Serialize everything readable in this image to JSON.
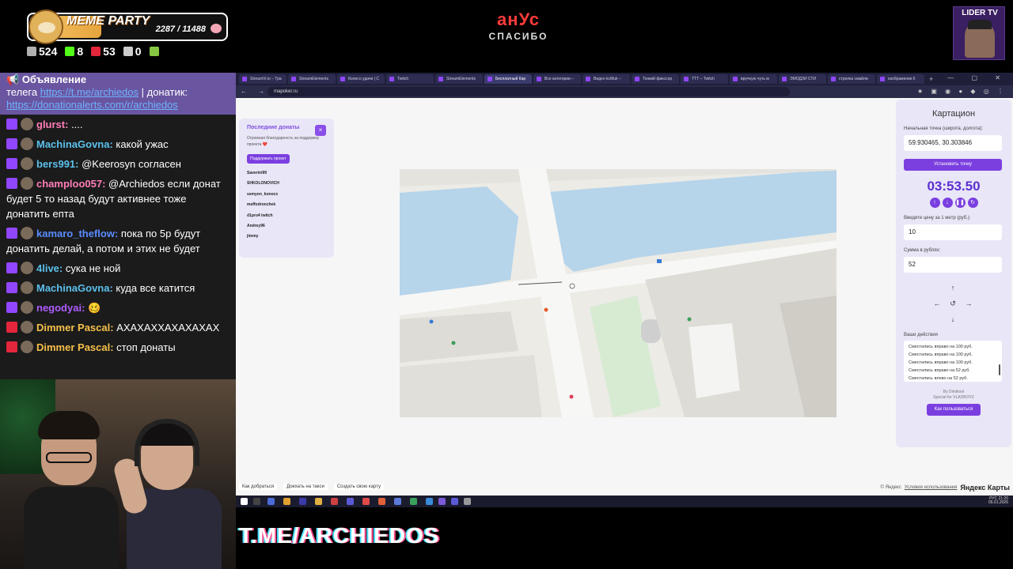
{
  "overlay": {
    "meme_party": {
      "title": "MEME PARTY",
      "count": "2287 / 11488",
      "progress": 0.199
    },
    "stats": [
      {
        "icon": "comment-icon",
        "value": "524",
        "color": "#b0b0b0"
      },
      {
        "icon": "kick-icon",
        "value": "8",
        "color": "#53fc18"
      },
      {
        "icon": "vk-live-icon",
        "value": "53",
        "color": "#e3263b"
      },
      {
        "icon": "wasd-icon",
        "value": "0",
        "color": "#cccccc"
      },
      {
        "icon": "rumble-icon",
        "value": "",
        "color": "#85c742"
      }
    ],
    "center": {
      "line1": "анУс",
      "line2": "СПАСИБО"
    },
    "lider": {
      "label": "LIDER TV"
    },
    "ticker": "T.ME/ARCHIEDOS"
  },
  "chat": {
    "announcement": {
      "title": "Объявление",
      "text_prefix": "телега ",
      "link1": "https://t.me/archiedos",
      "text_mid": " | донатик:",
      "link2": "https://donationalerts.com/r/archiedos"
    },
    "messages": [
      {
        "platform": "twitch",
        "nick": "glurst:",
        "color": "#ff7eb8",
        "text": " ...."
      },
      {
        "platform": "twitch",
        "nick": "MachinaGovna:",
        "color": "#5bc0eb",
        "text": " какой ужас"
      },
      {
        "platform": "twitch",
        "nick": "bers991:",
        "color": "#5bc0eb",
        "text": " @Keerosyn согласен"
      },
      {
        "platform": "twitch",
        "nick": "champloo057:",
        "color": "#ff7eb8",
        "text": " @Archiedos если донат будет 5 то назад будут активнее тоже донатить епта"
      },
      {
        "platform": "twitch",
        "nick": "kamaro_theflow:",
        "color": "#5b8cff",
        "text": " пока по 5р будут донатить делай, а потом и этих не будет"
      },
      {
        "platform": "twitch",
        "nick": "4live:",
        "color": "#5bc0eb",
        "text": " сука не ной"
      },
      {
        "platform": "twitch",
        "nick": "MachinaGovna:",
        "color": "#5bc0eb",
        "text": " куда все катится"
      },
      {
        "platform": "twitch",
        "nick": "negodyai:",
        "color": "#b05cff",
        "text": " 🥴"
      },
      {
        "platform": "vk",
        "nick": "Dimmer Pascal:",
        "color": "#f5c04a",
        "text": " АХАХАХХАХАХАХАХ"
      },
      {
        "platform": "vk",
        "nick": "Dimmer Pascal:",
        "color": "#f5c04a",
        "text": " стоп донаты"
      }
    ]
  },
  "browser": {
    "tabs": [
      {
        "label": "StreamVi.io – Тра",
        "active": false
      },
      {
        "label": "StreamElements",
        "active": false
      },
      {
        "label": "Колесо удачи | С",
        "active": false
      },
      {
        "label": "Twitch",
        "active": false
      },
      {
        "label": "StreamElements",
        "active": false
      },
      {
        "label": "Бесплатный Кар",
        "active": true
      },
      {
        "label": "Все категории –",
        "active": false
      },
      {
        "label": "Видео kcMuk –",
        "active": false
      },
      {
        "label": "Тонкий фикссор",
        "active": false
      },
      {
        "label": "ТТТ – Twitch",
        "active": false
      },
      {
        "label": "вручную чуть м",
        "active": false
      },
      {
        "label": "ЭМОДЗИ СТИ",
        "active": false
      },
      {
        "label": "стрелка смайли",
        "active": false
      },
      {
        "label": "изображение ll",
        "active": false
      }
    ],
    "url": "mapoker.ru"
  },
  "donations": {
    "title": "Последние донаты",
    "close": "×",
    "subtitle": "Огромная благодарность за поддержку проекта ❤️",
    "button": "Поддержать проект",
    "items": [
      "Saverini99",
      "SHKOLONOVICH",
      "semyon_konocx",
      "meffodronchek",
      "d1pro4 twitch",
      "Andrey96",
      "jimmy"
    ]
  },
  "panel": {
    "title": "Картацион",
    "start_label": "Начальная точка (широта, долгота):",
    "start_value": "59.930465, 30.303846",
    "set_button": "Установить точку",
    "timer": "03:53.50",
    "timer_controls": [
      "↑",
      "↓",
      "❚❚",
      "↻"
    ],
    "price_label": "Введите цену за 1 метр (руб.):",
    "price_value": "10",
    "sum_label": "Сумма в рублях:",
    "sum_value": "52",
    "arrows": {
      "up": "↑",
      "left": "←",
      "reset": "↺",
      "right": "→",
      "down": "↓"
    },
    "actions_label": "Ваши действия",
    "actions": [
      "Сместились вправо на 100 руб.",
      "Сместились вправо на 100 руб.",
      "Сместились вправо на 100 руб.",
      "Сместились вправо на 52 руб.",
      "Сместились влево на 52 руб."
    ],
    "credit1": "By Dimikool",
    "credit2": "Special for VLADBOYZ",
    "howto_button": "Как пользоваться"
  },
  "map_footer": {
    "route": "Как добраться",
    "taxi": "Доехать на такси",
    "create_map": "Создать свою карту",
    "copyright": "© Яндекс",
    "terms": "Условия использования",
    "brand": "Яндекс Карты"
  },
  "taskbar": {
    "time": "21:20",
    "date": "05.01.2026",
    "lang": "РУС"
  },
  "colors": {
    "accent": "#7b3fe0",
    "water": "#b6d4ea",
    "chat_bg": "#1b1b1b",
    "announce": "#6a55a0"
  }
}
